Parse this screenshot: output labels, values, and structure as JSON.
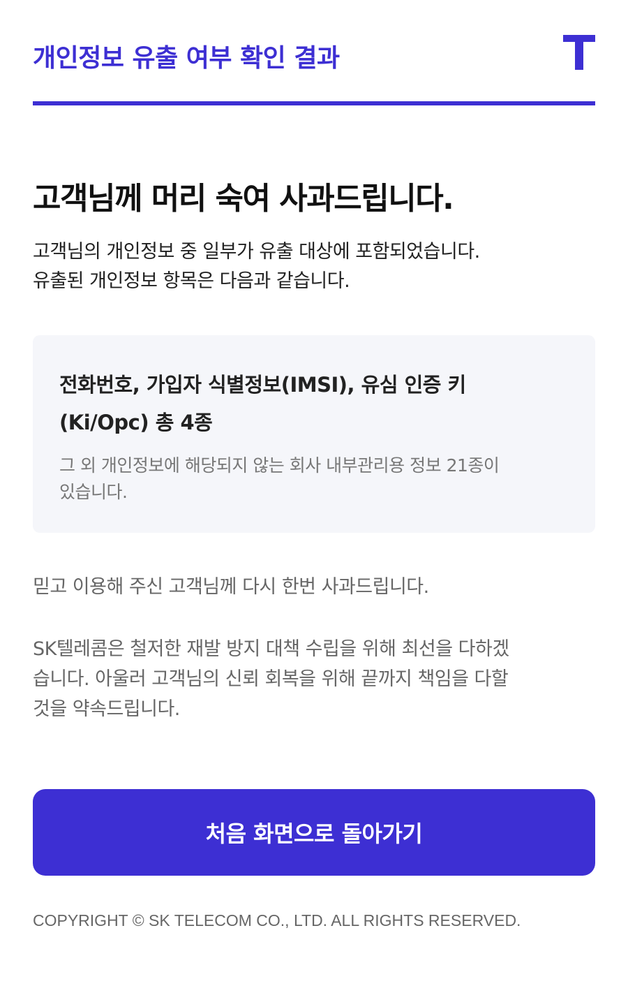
{
  "header": {
    "title": "개인정보 유출 여부 확인 결과",
    "logo_icon": "t-logo-icon",
    "accent_color": "#3d2fd3"
  },
  "main": {
    "headline": "고객님께 머리 숙여 사과드립니다.",
    "intro_lines": [
      "고객님의 개인정보 중 일부가 유출 대상에 포함되었습니다.",
      "유출된 개인정보 항목은 다음과 같습니다."
    ],
    "leaked_items_lines": [
      "전화번호, 가입자 식별정보(IMSI), 유심 인증 키",
      "(Ki/Opc) 총 4종"
    ],
    "note_lines": [
      "그 외 개인정보에 해당되지 않는 회사 내부관리용 정보 21종이",
      "있습니다."
    ],
    "closing_1": "믿고 이용해 주신 고객님께 다시 한번 사과드립니다.",
    "closing_2_lines": [
      "SK텔레콤은 철저한 재발 방지 대책 수립을 위해 최선을 다하겠",
      "습니다. 아울러 고객님의 신뢰 회복을 위해 끝까지 책임을 다할",
      "것을 약속드립니다."
    ]
  },
  "actions": {
    "home_button_label": "처음 화면으로 돌아가기"
  },
  "footer": {
    "copyright": "COPYRIGHT © SK TELECOM CO., LTD. ALL RIGHTS RESERVED."
  }
}
